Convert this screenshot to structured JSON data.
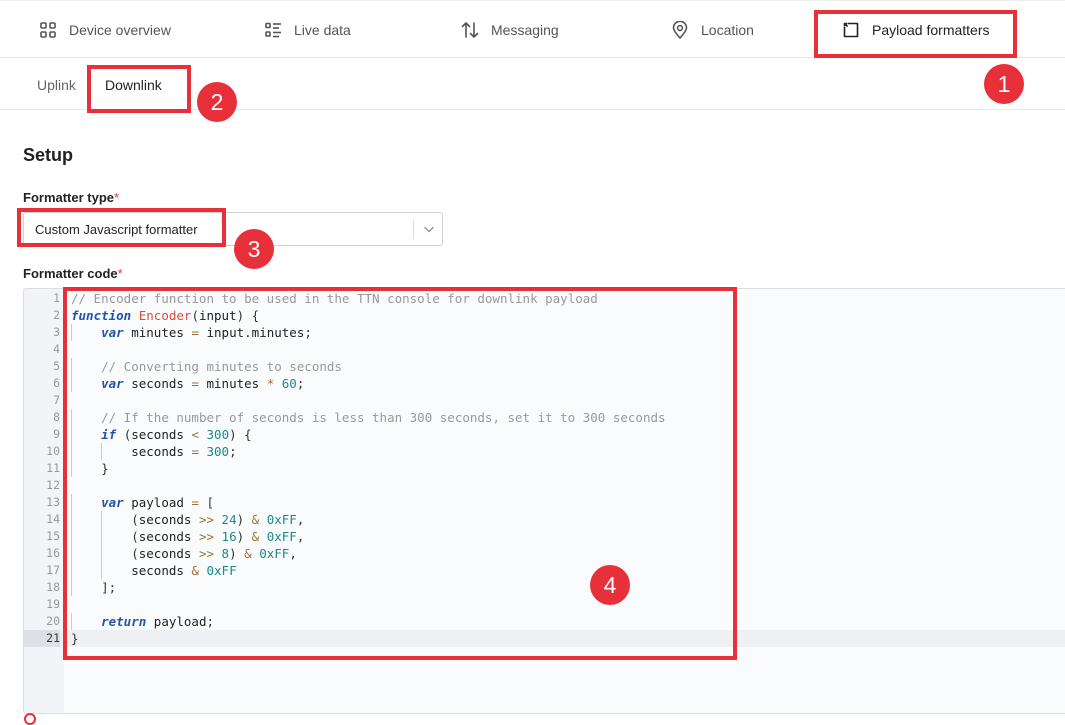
{
  "tabs": [
    {
      "label": "Device overview",
      "icon": "grid-icon"
    },
    {
      "label": "Live data",
      "icon": "list-icon"
    },
    {
      "label": "Messaging",
      "icon": "updown-arrows-icon"
    },
    {
      "label": "Location",
      "icon": "location-pin-icon"
    },
    {
      "label": "Payload formatters",
      "icon": "formatter-icon",
      "active": true
    }
  ],
  "subtabs": [
    {
      "label": "Uplink"
    },
    {
      "label": "Downlink",
      "active": true
    }
  ],
  "setup_title": "Setup",
  "formatter_type_label": "Formatter type",
  "formatter_type_value": "Custom Javascript formatter",
  "formatter_code_label": "Formatter code",
  "required_mark": "*",
  "annotations": [
    "1",
    "2",
    "3",
    "4"
  ],
  "accent_color": "#e8303a",
  "code_lines": [
    "// Encoder function to be used in the TTN console for downlink payload",
    "function Encoder(input) {",
    "    var minutes = input.minutes;",
    "",
    "    // Converting minutes to seconds",
    "    var seconds = minutes * 60;",
    "",
    "    // If the number of seconds is less than 300 seconds, set it to 300 seconds",
    "    if (seconds < 300) {",
    "        seconds = 300;",
    "    }",
    "",
    "    var payload = [",
    "        (seconds >> 24) & 0xFF,",
    "        (seconds >> 16) & 0xFF,",
    "        (seconds >> 8) & 0xFF,",
    "        seconds & 0xFF",
    "    ];",
    "",
    "    return payload;",
    "}"
  ]
}
